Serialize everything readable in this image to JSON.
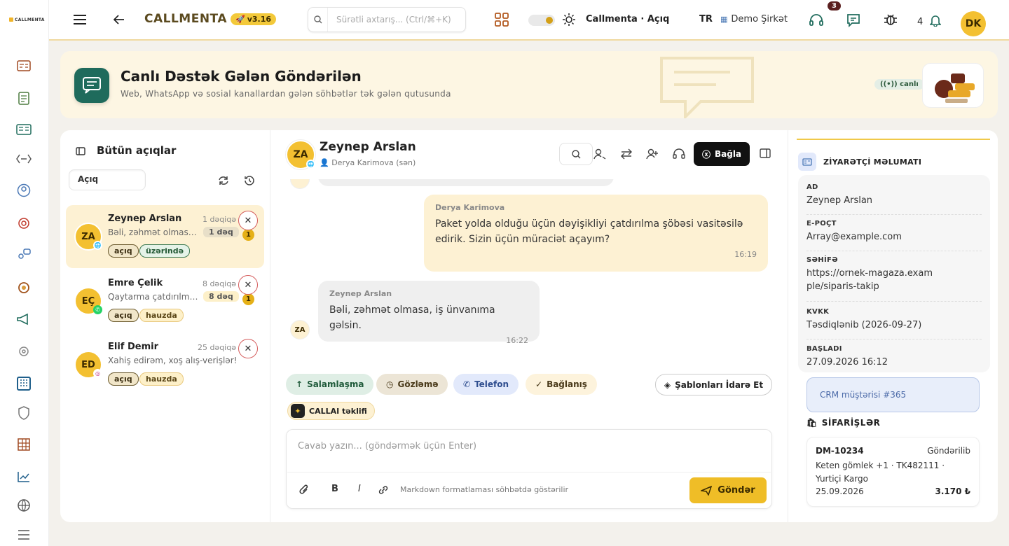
{
  "app": {
    "brand": "CALLMENTA",
    "version": "v3.16",
    "logo_text": "CALLMENTA"
  },
  "topbar": {
    "search_placeholder": "Sürətli axtarış... (Ctrl/⌘+K)",
    "status": "Callmenta · Açıq",
    "lang": "TR",
    "company": "Demo Şirkət",
    "support_badge": "3",
    "notif_count": "4",
    "avatar": "DK"
  },
  "hero": {
    "title": "Canlı Dəstək Gələn Göndərilən",
    "subtitle": "Web, WhatsApp və sosial kanallardan gələn söhbətlər tək gələn qutusunda",
    "live": "canlı"
  },
  "list": {
    "title": "Bütün açıqlar",
    "filter": "Açıq",
    "items": [
      {
        "initials": "ZA",
        "name": "Zeynep Arslan",
        "time": "1 dəqiqə",
        "preview": "Bəli, zəhmət olmasa, iş ünvanıma gəlsin.",
        "duration": "1 dəq",
        "count": "1",
        "tag1": "açıq",
        "tag2": "üzərində",
        "channel": "web-icon"
      },
      {
        "initials": "EÇ",
        "name": "Emre Çelik",
        "time": "8 dəqiqə",
        "preview": "Qaytarma çatdırılması",
        "duration": "8 dəq",
        "count": "1",
        "tag1": "açıq",
        "tag2": "hauzda",
        "channel": "whatsapp-icon"
      },
      {
        "initials": "ED",
        "name": "Elif Demir",
        "time": "25 dəqiqə",
        "preview": "Xahiş edirəm, xoş alış-verişlər!",
        "tag1": "açıq",
        "tag2": "hauzda",
        "channel": "instagram-icon"
      }
    ]
  },
  "chat": {
    "initials": "ZA",
    "name": "Zeynep Arslan",
    "assignee": "Derya Karimova (sən)",
    "close_label": "Bağla",
    "messages": [
      {
        "from": "Derya Karimova",
        "text": "Paket yolda olduğu üçün dəyişikliyi çatdırılma şöbəsi vasitəsilə edirik. Sizin üçün müraciət açayım?",
        "time": "16:19"
      },
      {
        "from": "Zeynep Arslan",
        "text": "Bəli, zəhmət olmasa, iş ünvanıma gəlsin.",
        "time": "16:22",
        "initials": "ZA"
      }
    ],
    "quick": [
      "Salamlaşma",
      "Gözləmə",
      "Telefon",
      "Bağlanış"
    ],
    "templates_label": "Şablonları İdarə Et",
    "ai_label": "CALLAI təklifi",
    "composer_placeholder": "Cavab yazın... (göndərmək üçün Enter)",
    "markdown_hint": "Markdown formatlaması söhbətdə göstərilir",
    "send_label": "Göndər"
  },
  "visitor": {
    "title": "ZİYARƏTÇİ MƏLUMATI",
    "fields": [
      {
        "label": "AD",
        "value": "Zeynep Arslan"
      },
      {
        "label": "E-POÇT",
        "value": "Array@example.com"
      },
      {
        "label": "SƏHİFƏ",
        "value": "https://ornek-magaza.example/siparis-takip"
      },
      {
        "label": "KVKK",
        "value": "Təsdiqlənib (2026-09-27)"
      },
      {
        "label": "BAŞLADI",
        "value": "27.09.2026 16:12"
      }
    ],
    "crm": "CRM müştərisi #365",
    "orders_title": "SİFARİŞLƏR",
    "order": {
      "id": "DM-10234",
      "status": "Göndərilib",
      "desc": "Keten gömlek +1 · TK482111 · Yurtiçi Kargo",
      "date": "25.09.2026",
      "amount": "3.170 ₺"
    }
  }
}
